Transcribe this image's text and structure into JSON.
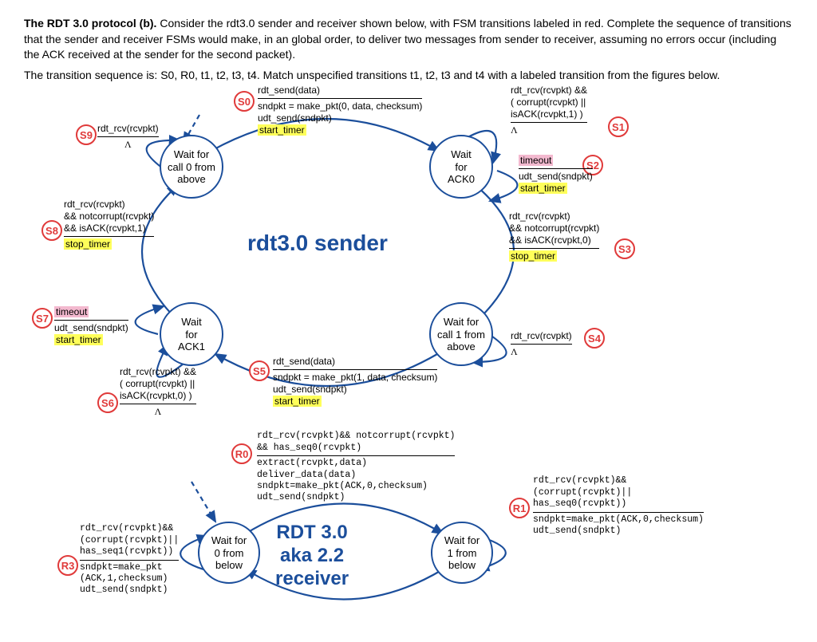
{
  "question": {
    "title_bold": "The RDT 3.0  protocol (b).",
    "p1": "  Consider the rdt3.0 sender and receiver shown below, with FSM transitions labeled in red.  Complete the sequence of transitions that the sender and receiver FSMs would make, in an global order, to deliver two messages from sender to receiver, assuming no errors occur (including the ACK received at the sender for the second packet).",
    "p2": "The transition sequence is: S0, R0, t1, t2, t3, t4.  Match unspecified transitions t1, t2, t3 and t4 with a labeled transition from the figures below."
  },
  "sender": {
    "title": "rdt3.0 sender",
    "states": {
      "wc0": "Wait for\ncall 0 from\nabove",
      "wa0": "Wait\nfor\nACK0",
      "wc1": "Wait for\ncall 1 from\nabove",
      "wa1": "Wait\nfor\nACK1"
    },
    "S0": {
      "evt": "rdt_send(data)",
      "a1": "sndpkt = make_pkt(0, data, checksum)",
      "a2": "udt_send(sndpkt)",
      "a3": "start_timer"
    },
    "S1": {
      "evt1": "rdt_rcv(rcvpkt) &&",
      "evt2": "( corrupt(rcvpkt) ||",
      "evt3": "isACK(rcvpkt,1) )",
      "act": "Λ"
    },
    "S2": {
      "evt": "timeout",
      "a1": "udt_send(sndpkt)",
      "a2": "start_timer"
    },
    "S3": {
      "evt1": "rdt_rcv(rcvpkt)",
      "evt2": "&& notcorrupt(rcvpkt)",
      "evt3": "&& isACK(rcvpkt,0)",
      "act": "stop_timer"
    },
    "S4": {
      "evt": "rdt_rcv(rcvpkt)",
      "act": "Λ"
    },
    "S5": {
      "evt": "rdt_send(data)",
      "a1": "sndpkt = make_pkt(1, data, checksum)",
      "a2": "udt_send(sndpkt)",
      "a3": "start_timer"
    },
    "S6": {
      "evt1": "rdt_rcv(rcvpkt) &&",
      "evt2": "( corrupt(rcvpkt) ||",
      "evt3": "isACK(rcvpkt,0) )",
      "act": "Λ"
    },
    "S7": {
      "evt": "timeout",
      "a1": "udt_send(sndpkt)",
      "a2": "start_timer"
    },
    "S8": {
      "evt1": "rdt_rcv(rcvpkt)",
      "evt2": "&& notcorrupt(rcvpkt)",
      "evt3": "&& isACK(rcvpkt,1)",
      "act": "stop_timer"
    },
    "S9": {
      "evt": "rdt_rcv(rcvpkt)",
      "act": "Λ"
    }
  },
  "receiver": {
    "title_l1": "RDT 3.0",
    "title_l2": "aka 2.2",
    "title_l3": "receiver",
    "states": {
      "w0": "Wait for\n0 from\nbelow",
      "w1": "Wait for\n1 from\nbelow"
    },
    "R0": {
      "evt1": "rdt_rcv(rcvpkt)&& notcorrupt(rcvpkt)",
      "evt2": "&& has_seq0(rcvpkt)",
      "a1": "extract(rcvpkt,data)",
      "a2": "deliver_data(data)",
      "a3": "sndpkt=make_pkt(ACK,0,checksum)",
      "a4": "udt_send(sndpkt)"
    },
    "R1": {
      "evt1": "rdt_rcv(rcvpkt)&&",
      "evt2": "(corrupt(rcvpkt)||",
      "evt3": "has_seq0(rcvpkt))",
      "a1": "sndpkt=make_pkt(ACK,0,checksum)",
      "a2": "udt_send(sndpkt)"
    },
    "R3": {
      "evt1": "rdt_rcv(rcvpkt)&&",
      "evt2": "(corrupt(rcvpkt)||",
      "evt3": "has_seq1(rcvpkt))",
      "a1": "sndpkt=make_pkt",
      "a2": "      (ACK,1,checksum)",
      "a3": "udt_send(sndpkt)"
    }
  },
  "tags": {
    "S0": "S0",
    "S1": "S1",
    "S2": "S2",
    "S3": "S3",
    "S4": "S4",
    "S5": "S5",
    "S6": "S6",
    "S7": "S7",
    "S8": "S8",
    "S9": "S9",
    "R0": "R0",
    "R1": "R1",
    "R3": "R3"
  }
}
